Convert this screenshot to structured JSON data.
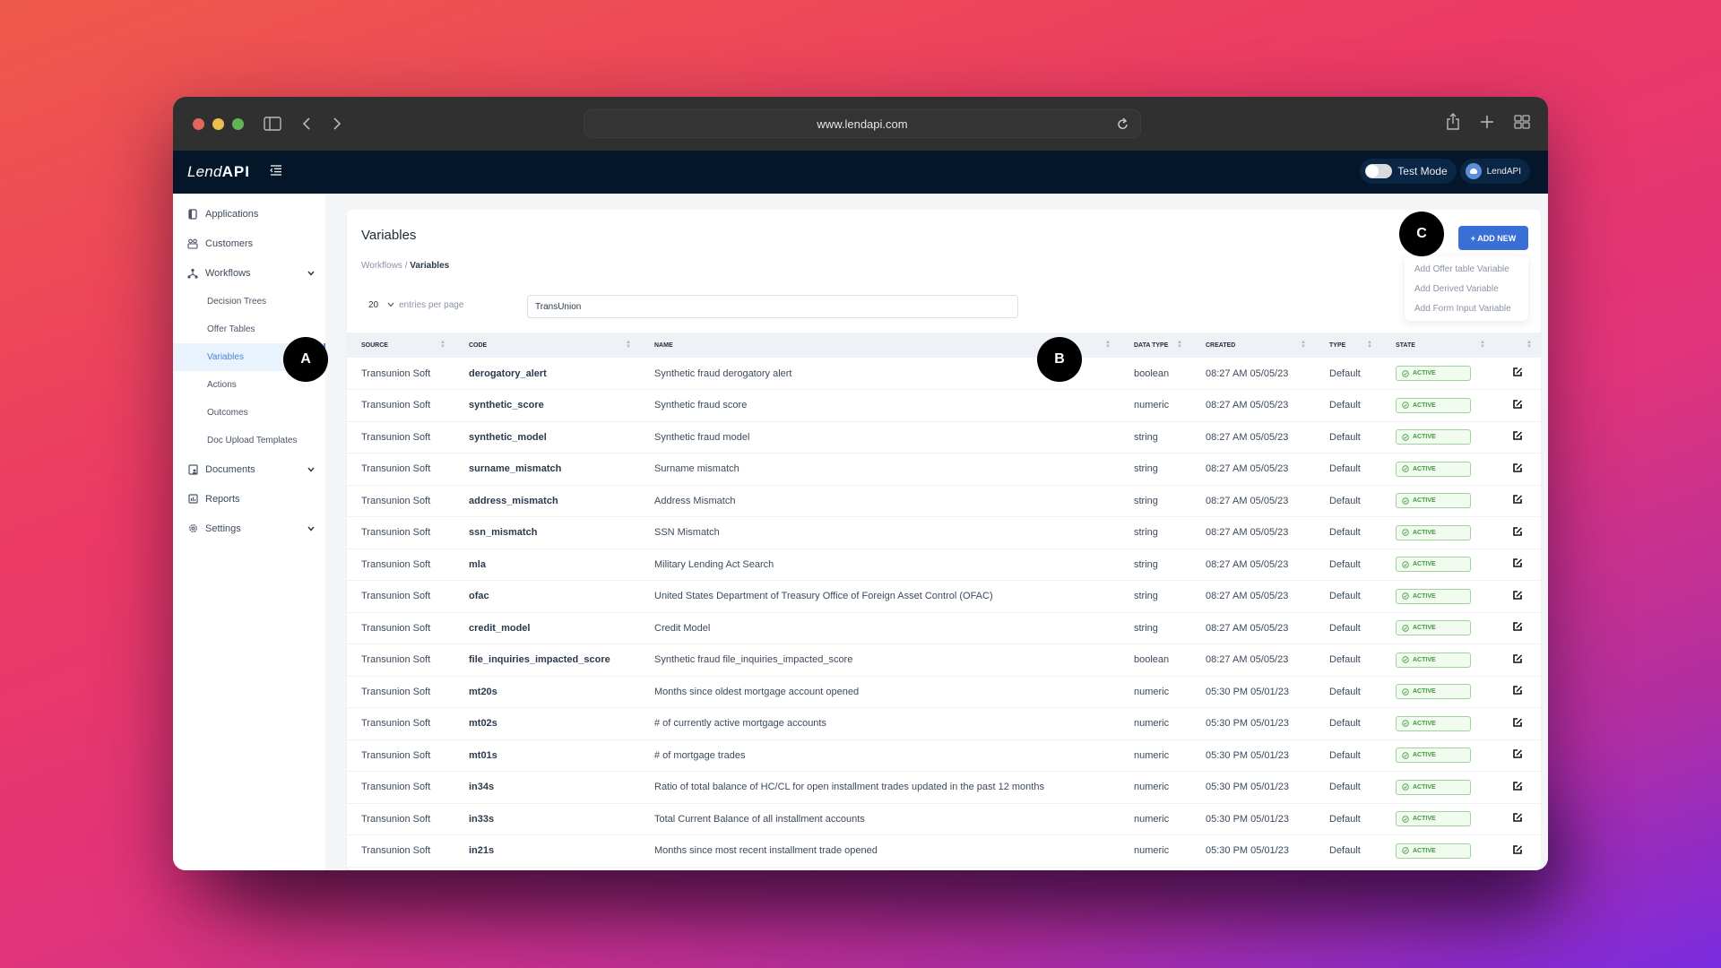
{
  "browser": {
    "url": "www.lendapi.com"
  },
  "app": {
    "logo_light": "Lend",
    "logo_bold": "API",
    "test_mode_label": "Test Mode",
    "account_label": "LendAPI"
  },
  "sidebar": {
    "items": [
      {
        "label": "Applications",
        "icon": "file-icon"
      },
      {
        "label": "Customers",
        "icon": "users-icon"
      },
      {
        "label": "Workflows",
        "icon": "workflow-icon",
        "expandable": true
      },
      {
        "label": "Documents",
        "icon": "document-icon",
        "expandable": true
      },
      {
        "label": "Reports",
        "icon": "chart-icon"
      },
      {
        "label": "Settings",
        "icon": "gear-icon",
        "expandable": true
      }
    ],
    "workflow_subitems": [
      {
        "label": "Decision Trees"
      },
      {
        "label": "Offer Tables"
      },
      {
        "label": "Variables",
        "active": true
      },
      {
        "label": "Actions"
      },
      {
        "label": "Outcomes"
      },
      {
        "label": "Doc Upload Templates"
      }
    ]
  },
  "page": {
    "title": "Variables",
    "breadcrumb_parent": "Workflows",
    "breadcrumb_sep": " / ",
    "breadcrumb_current": "Variables",
    "add_new_label": "+ ADD NEW",
    "add_menu": [
      "Add Offer table Variable",
      "Add Derived Variable",
      "Add Form Input Variable"
    ],
    "entries_value": "20",
    "entries_label": "entries per page",
    "search_value": "TransUnion"
  },
  "table": {
    "columns": [
      "Source",
      "Code",
      "Name",
      "Data Type",
      "Created",
      "Type",
      "State",
      ""
    ],
    "rows": [
      {
        "source": "Transunion Soft",
        "code": "derogatory_alert",
        "name": "Synthetic fraud derogatory alert",
        "data_type": "boolean",
        "created": "08:27 AM 05/05/23",
        "type": "Default",
        "state": "ACTIVE"
      },
      {
        "source": "Transunion Soft",
        "code": "synthetic_score",
        "name": "Synthetic fraud score",
        "data_type": "numeric",
        "created": "08:27 AM 05/05/23",
        "type": "Default",
        "state": "ACTIVE"
      },
      {
        "source": "Transunion Soft",
        "code": "synthetic_model",
        "name": "Synthetic fraud model",
        "data_type": "string",
        "created": "08:27 AM 05/05/23",
        "type": "Default",
        "state": "ACTIVE"
      },
      {
        "source": "Transunion Soft",
        "code": "surname_mismatch",
        "name": "Surname mismatch",
        "data_type": "string",
        "created": "08:27 AM 05/05/23",
        "type": "Default",
        "state": "ACTIVE"
      },
      {
        "source": "Transunion Soft",
        "code": "address_mismatch",
        "name": "Address Mismatch",
        "data_type": "string",
        "created": "08:27 AM 05/05/23",
        "type": "Default",
        "state": "ACTIVE"
      },
      {
        "source": "Transunion Soft",
        "code": "ssn_mismatch",
        "name": "SSN Mismatch",
        "data_type": "string",
        "created": "08:27 AM 05/05/23",
        "type": "Default",
        "state": "ACTIVE"
      },
      {
        "source": "Transunion Soft",
        "code": "mla",
        "name": "Military Lending Act Search",
        "data_type": "string",
        "created": "08:27 AM 05/05/23",
        "type": "Default",
        "state": "ACTIVE"
      },
      {
        "source": "Transunion Soft",
        "code": "ofac",
        "name": "United States Department of Treasury Office of Foreign Asset Control (OFAC)",
        "data_type": "string",
        "created": "08:27 AM 05/05/23",
        "type": "Default",
        "state": "ACTIVE"
      },
      {
        "source": "Transunion Soft",
        "code": "credit_model",
        "name": "Credit Model",
        "data_type": "string",
        "created": "08:27 AM 05/05/23",
        "type": "Default",
        "state": "ACTIVE"
      },
      {
        "source": "Transunion Soft",
        "code": "file_inquiries_impacted_score",
        "name": "Synthetic fraud file_inquiries_impacted_score",
        "data_type": "boolean",
        "created": "08:27 AM 05/05/23",
        "type": "Default",
        "state": "ACTIVE"
      },
      {
        "source": "Transunion Soft",
        "code": "mt20s",
        "name": "Months since oldest mortgage account opened",
        "data_type": "numeric",
        "created": "05:30 PM 05/01/23",
        "type": "Default",
        "state": "ACTIVE"
      },
      {
        "source": "Transunion Soft",
        "code": "mt02s",
        "name": "# of currently active mortgage accounts",
        "data_type": "numeric",
        "created": "05:30 PM 05/01/23",
        "type": "Default",
        "state": "ACTIVE"
      },
      {
        "source": "Transunion Soft",
        "code": "mt01s",
        "name": "# of mortgage trades",
        "data_type": "numeric",
        "created": "05:30 PM 05/01/23",
        "type": "Default",
        "state": "ACTIVE"
      },
      {
        "source": "Transunion Soft",
        "code": "in34s",
        "name": "Ratio of total balance of HC/CL for open installment trades updated in the past 12 months",
        "data_type": "numeric",
        "created": "05:30 PM 05/01/23",
        "type": "Default",
        "state": "ACTIVE"
      },
      {
        "source": "Transunion Soft",
        "code": "in33s",
        "name": "Total Current Balance of all installment accounts",
        "data_type": "numeric",
        "created": "05:30 PM 05/01/23",
        "type": "Default",
        "state": "ACTIVE"
      },
      {
        "source": "Transunion Soft",
        "code": "in21s",
        "name": "Months since most recent installment trade opened",
        "data_type": "numeric",
        "created": "05:30 PM 05/01/23",
        "type": "Default",
        "state": "ACTIVE"
      }
    ]
  },
  "callouts": [
    "A",
    "B",
    "C"
  ],
  "colors": {
    "accent": "#3a6fd8",
    "header_bg": "#04172a",
    "active_badge": "#3f9c3a"
  }
}
